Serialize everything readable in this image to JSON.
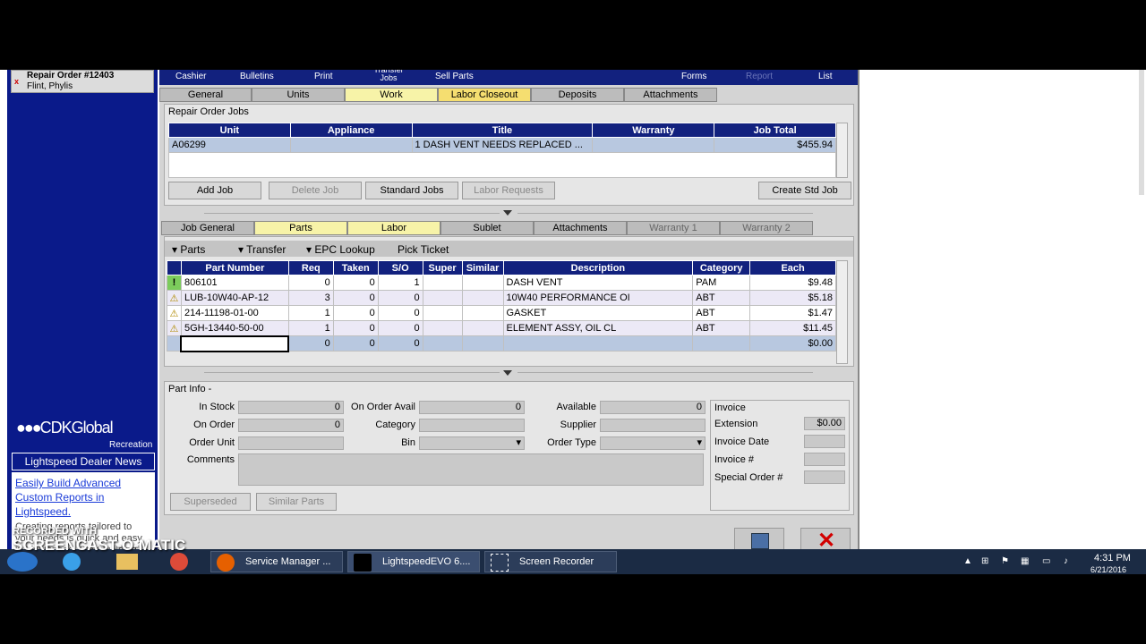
{
  "repair_order": {
    "title": "Repair Order #12403",
    "customer": "Flint, Phylis"
  },
  "menubar": [
    "Cashier",
    "Bulletins",
    "Print",
    "Transfer Jobs",
    "Sell Parts",
    "Forms",
    "Report",
    "List"
  ],
  "main_tabs": [
    "General",
    "Units",
    "Work",
    "Labor Closeout",
    "Deposits",
    "Attachments"
  ],
  "jobs_section": {
    "title": "Repair Order Jobs",
    "columns": [
      "Unit",
      "Appliance",
      "Title",
      "Warranty",
      "Job Total"
    ],
    "row": {
      "unit": "A06299",
      "appliance": "",
      "title": "1  DASH VENT NEEDS REPLACED ...",
      "warranty": "",
      "job_total": "$455.94"
    },
    "buttons": {
      "add_job": "Add Job",
      "delete_job": "Delete Job",
      "standard_jobs": "Standard Jobs",
      "labor_requests": "Labor Requests",
      "create_std_job": "Create Std Job"
    }
  },
  "job_tabs": [
    "Job General",
    "Parts",
    "Labor",
    "Sublet",
    "Attachments",
    "Warranty 1",
    "Warranty 2"
  ],
  "parts_toolbar": {
    "parts": "Parts",
    "transfer": "Transfer",
    "epc": "EPC Lookup",
    "pick": "Pick Ticket"
  },
  "parts_grid": {
    "columns": [
      "Part Number",
      "Req",
      "Taken",
      "S/O",
      "Super",
      "Similar",
      "Description",
      "Category",
      "Each"
    ],
    "rows": [
      {
        "flag": "!",
        "part": "806101",
        "req": "0",
        "taken": "0",
        "so": "1",
        "super": "",
        "similar": "",
        "desc": "DASH VENT",
        "cat": "PAM",
        "each": "$9.48"
      },
      {
        "flag": "warn",
        "part": "LUB-10W40-AP-12",
        "req": "3",
        "taken": "0",
        "so": "0",
        "super": "",
        "similar": "",
        "desc": "10W40 PERFORMANCE OI",
        "cat": "ABT",
        "each": "$5.18"
      },
      {
        "flag": "warn",
        "part": "214-11198-01-00",
        "req": "1",
        "taken": "0",
        "so": "0",
        "super": "",
        "similar": "",
        "desc": "GASKET",
        "cat": "ABT",
        "each": "$1.47"
      },
      {
        "flag": "warn",
        "part": "5GH-13440-50-00",
        "req": "1",
        "taken": "0",
        "so": "0",
        "super": "",
        "similar": "",
        "desc": "ELEMENT ASSY, OIL CL",
        "cat": "ABT",
        "each": "$11.45"
      },
      {
        "flag": "",
        "part": "",
        "req": "0",
        "taken": "0",
        "so": "0",
        "super": "",
        "similar": "",
        "desc": "",
        "cat": "",
        "each": "$0.00"
      }
    ]
  },
  "part_info": {
    "title": "Part Info -",
    "labels": {
      "in_stock": "In Stock",
      "on_order": "On Order",
      "order_unit": "Order Unit",
      "comments": "Comments",
      "on_order_avail": "On Order Avail",
      "category": "Category",
      "bin": "Bin",
      "available": "Available",
      "supplier": "Supplier",
      "order_type": "Order Type"
    },
    "values": {
      "in_stock": "0",
      "on_order": "0",
      "on_order_avail": "0",
      "available": "0"
    },
    "buttons": {
      "superseded": "Superseded",
      "similar": "Similar Parts"
    }
  },
  "invoice": {
    "title": "Invoice",
    "extension_label": "Extension",
    "extension": "$0.00",
    "date_label": "Invoice Date",
    "number_label": "Invoice #",
    "special_label": "Special Order #"
  },
  "news": {
    "header": "Lightspeed Dealer News",
    "link": "Easily Build Advanced Custom Reports in Lightspeed.",
    "text": "Creating reports tailored to your needs is quick and easy in Lightspeed. Start building"
  },
  "logo": {
    "name": "CDKGlobal",
    "sub": "Recreation"
  },
  "taskbar": {
    "items": [
      "Service Manager ...",
      "LightspeedEVO 6....",
      "Screen Recorder"
    ],
    "time": "4:31 PM",
    "date": "6/21/2016"
  },
  "watermark": {
    "line1": "RECORDED WITH",
    "line2": "SCREENCAST-O-MATIC"
  },
  "colors": {
    "navy": "#12217e",
    "tab_active": "#f7f3a8",
    "tab_highlight": "#f5de70"
  }
}
